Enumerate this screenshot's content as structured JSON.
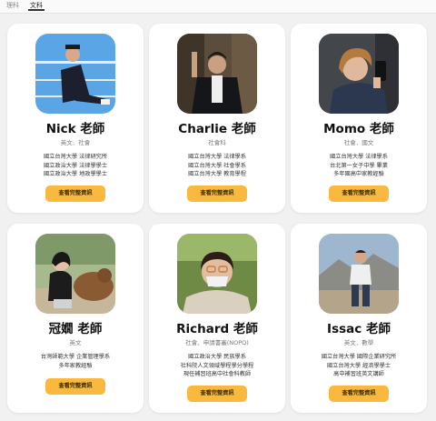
{
  "tabs": [
    {
      "label": "理科",
      "active": false
    },
    {
      "label": "文科",
      "active": true
    }
  ],
  "colors": {
    "button": "#f9b93e",
    "card": "#ffffff",
    "background": "#f1f1f1"
  },
  "teachers": [
    {
      "name": "Nick 老師",
      "subjects": "英文．社會",
      "education": [
        "國立台灣大學 法律研究所",
        "國立政治大學 法律學學士",
        "國立政治大學 地政學學士"
      ],
      "button": "查看完整資訊"
    },
    {
      "name": "Charlie 老師",
      "subjects": "社會科",
      "education": [
        "國立台灣大學 法律學系",
        "國立台灣大學 社會學系",
        "國立台灣大學 教育學程"
      ],
      "button": "查看完整資訊"
    },
    {
      "name": "Momo 老師",
      "subjects": "社會．國文",
      "education": [
        "國立台灣大學 法律學系",
        "台北第一女子中學 畢業",
        "多年國高中家教經驗"
      ],
      "button": "查看完整資訊"
    },
    {
      "name": "冠嫺 老師",
      "subjects": "英文",
      "education": [
        "台灣師範大學 企業管理學系",
        "多年家教經驗"
      ],
      "button": "查看完整資訊"
    },
    {
      "name": "Richard 老師",
      "subjects": "社會、申請書審(NOPQ)",
      "education": [
        "國立政治大學 民族學系",
        "社科院人文領域學程學分學程",
        "現任補習班高中社會科教師"
      ],
      "button": "查看完整資訊"
    },
    {
      "name": "Issac 老師",
      "subjects": "英文．數學",
      "education": [
        "國立台灣大學 國際企業研究所",
        "國立台灣大學 經濟學學士",
        "高中補習班英文講師"
      ],
      "button": "查看完整資訊"
    }
  ]
}
